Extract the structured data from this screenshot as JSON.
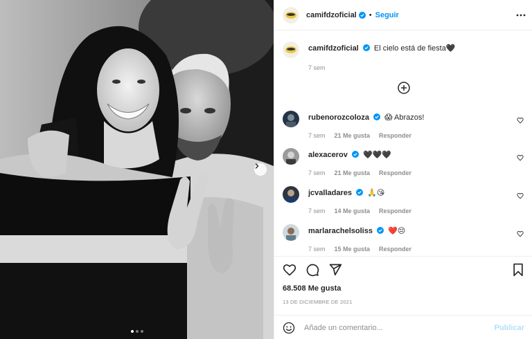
{
  "post": {
    "username": "camifdzoficial",
    "follow_label": "Seguir",
    "more_icon": "more-options-icon",
    "caption": "El cielo está de fiesta🖤",
    "caption_time": "7 sem",
    "load_more_icon": "plus-circle-icon",
    "carousel_dots": 3,
    "carousel_active": 0
  },
  "comments": [
    {
      "username": "rubenorozcoloza",
      "text": "😱 Abrazos!",
      "time": "7 sem",
      "likes": "21 Me gusta",
      "reply": "Responder"
    },
    {
      "username": "alexacerov",
      "text": "🖤🖤🖤",
      "time": "7 sem",
      "likes": "21 Me gusta",
      "reply": "Responder"
    },
    {
      "username": "jcvalladares",
      "text": "🙏😘",
      "time": "7 sem",
      "likes": "14 Me gusta",
      "reply": "Responder"
    },
    {
      "username": "marlarachelsoliss",
      "text": "❤️😔",
      "time": "7 sem",
      "likes": "15 Me gusta",
      "reply": "Responder"
    }
  ],
  "actions": {
    "likes": "68.508 Me gusta",
    "date": "13 DE DICIEMBRE DE 2021",
    "comment_placeholder": "Añade un comentario...",
    "publish_label": "Publicar"
  },
  "colors": {
    "accent": "#0095f6",
    "muted": "#8e8e8e",
    "publish_disabled": "#b2dffc"
  }
}
